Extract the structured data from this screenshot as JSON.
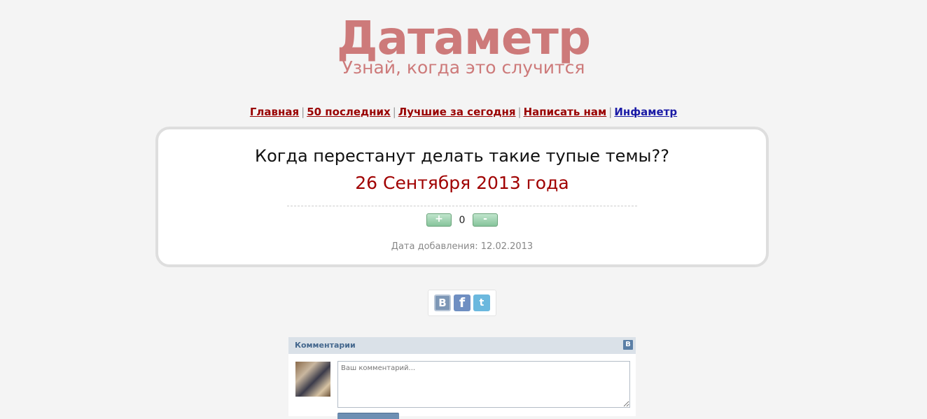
{
  "logo": {
    "title": "Датаметр",
    "tagline": "Узнай, когда это случится"
  },
  "nav": {
    "items": [
      {
        "label": "Главная"
      },
      {
        "label": "50 последних"
      },
      {
        "label": "Лучшие за сегодня"
      },
      {
        "label": "Написать нам"
      },
      {
        "label": "Инфаметр"
      }
    ],
    "separator": "|"
  },
  "question": {
    "text": "Когда перестанут делать такие тупые темы??",
    "date": "26 Сентября 2013 года",
    "vote_plus": "+",
    "vote_count": "0",
    "vote_minus": "-",
    "added": "Дата добавления: 12.02.2013"
  },
  "share": {
    "icons": [
      "vk-icon",
      "facebook-icon",
      "twitter-icon"
    ],
    "vk_glyph": "В",
    "fb_glyph": "f",
    "tw_glyph": "t"
  },
  "comments": {
    "title": "Комментарии",
    "vk_badge": "В",
    "placeholder": "Ваш комментарий..."
  },
  "colors": {
    "logo": "#cd7a7a",
    "nav_link": "#990000",
    "nav_info": "#1a1aa6",
    "date": "#a00000",
    "vk_header": "#dae1e8"
  }
}
